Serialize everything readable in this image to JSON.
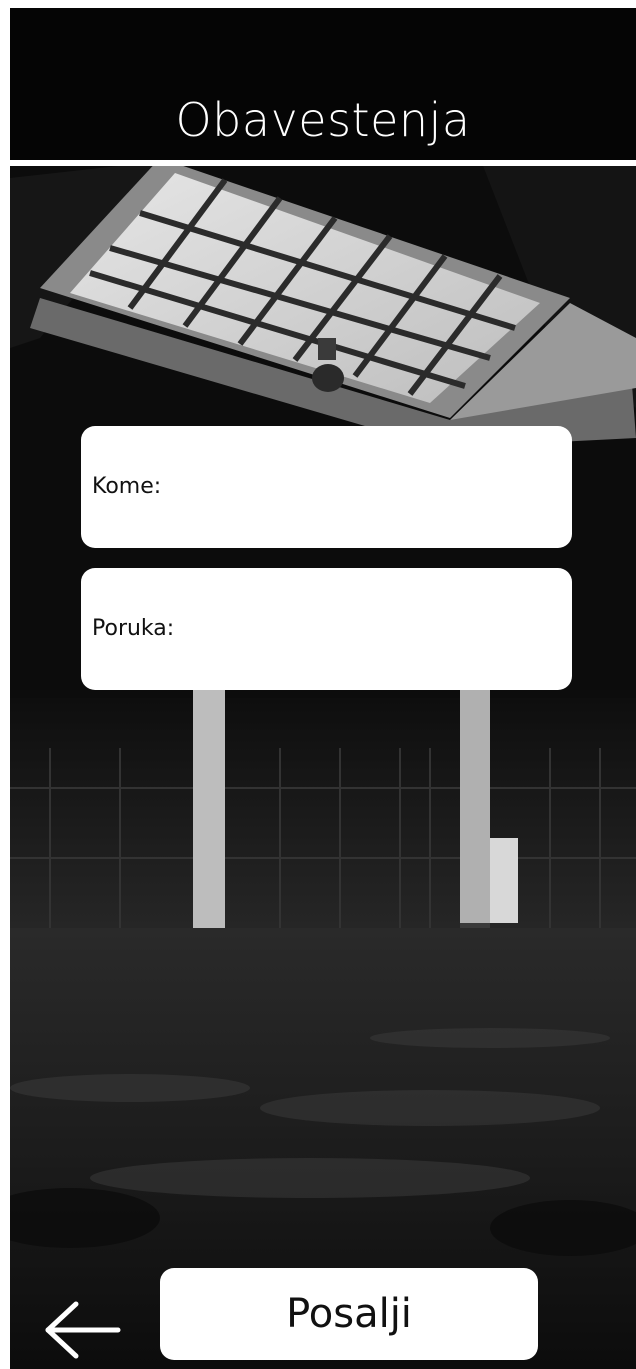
{
  "header": {
    "title": "Obavestenja"
  },
  "form": {
    "recipient_label": "Kome:",
    "message_label": "Poruka:"
  },
  "actions": {
    "send_label": "Posalji",
    "back_icon": "arrow-left-icon"
  },
  "colors": {
    "header_background": "#050505",
    "divider": "#ffffff",
    "field_background": "#ffffff",
    "text_dark": "#111111",
    "title_text": "#ffffff"
  }
}
